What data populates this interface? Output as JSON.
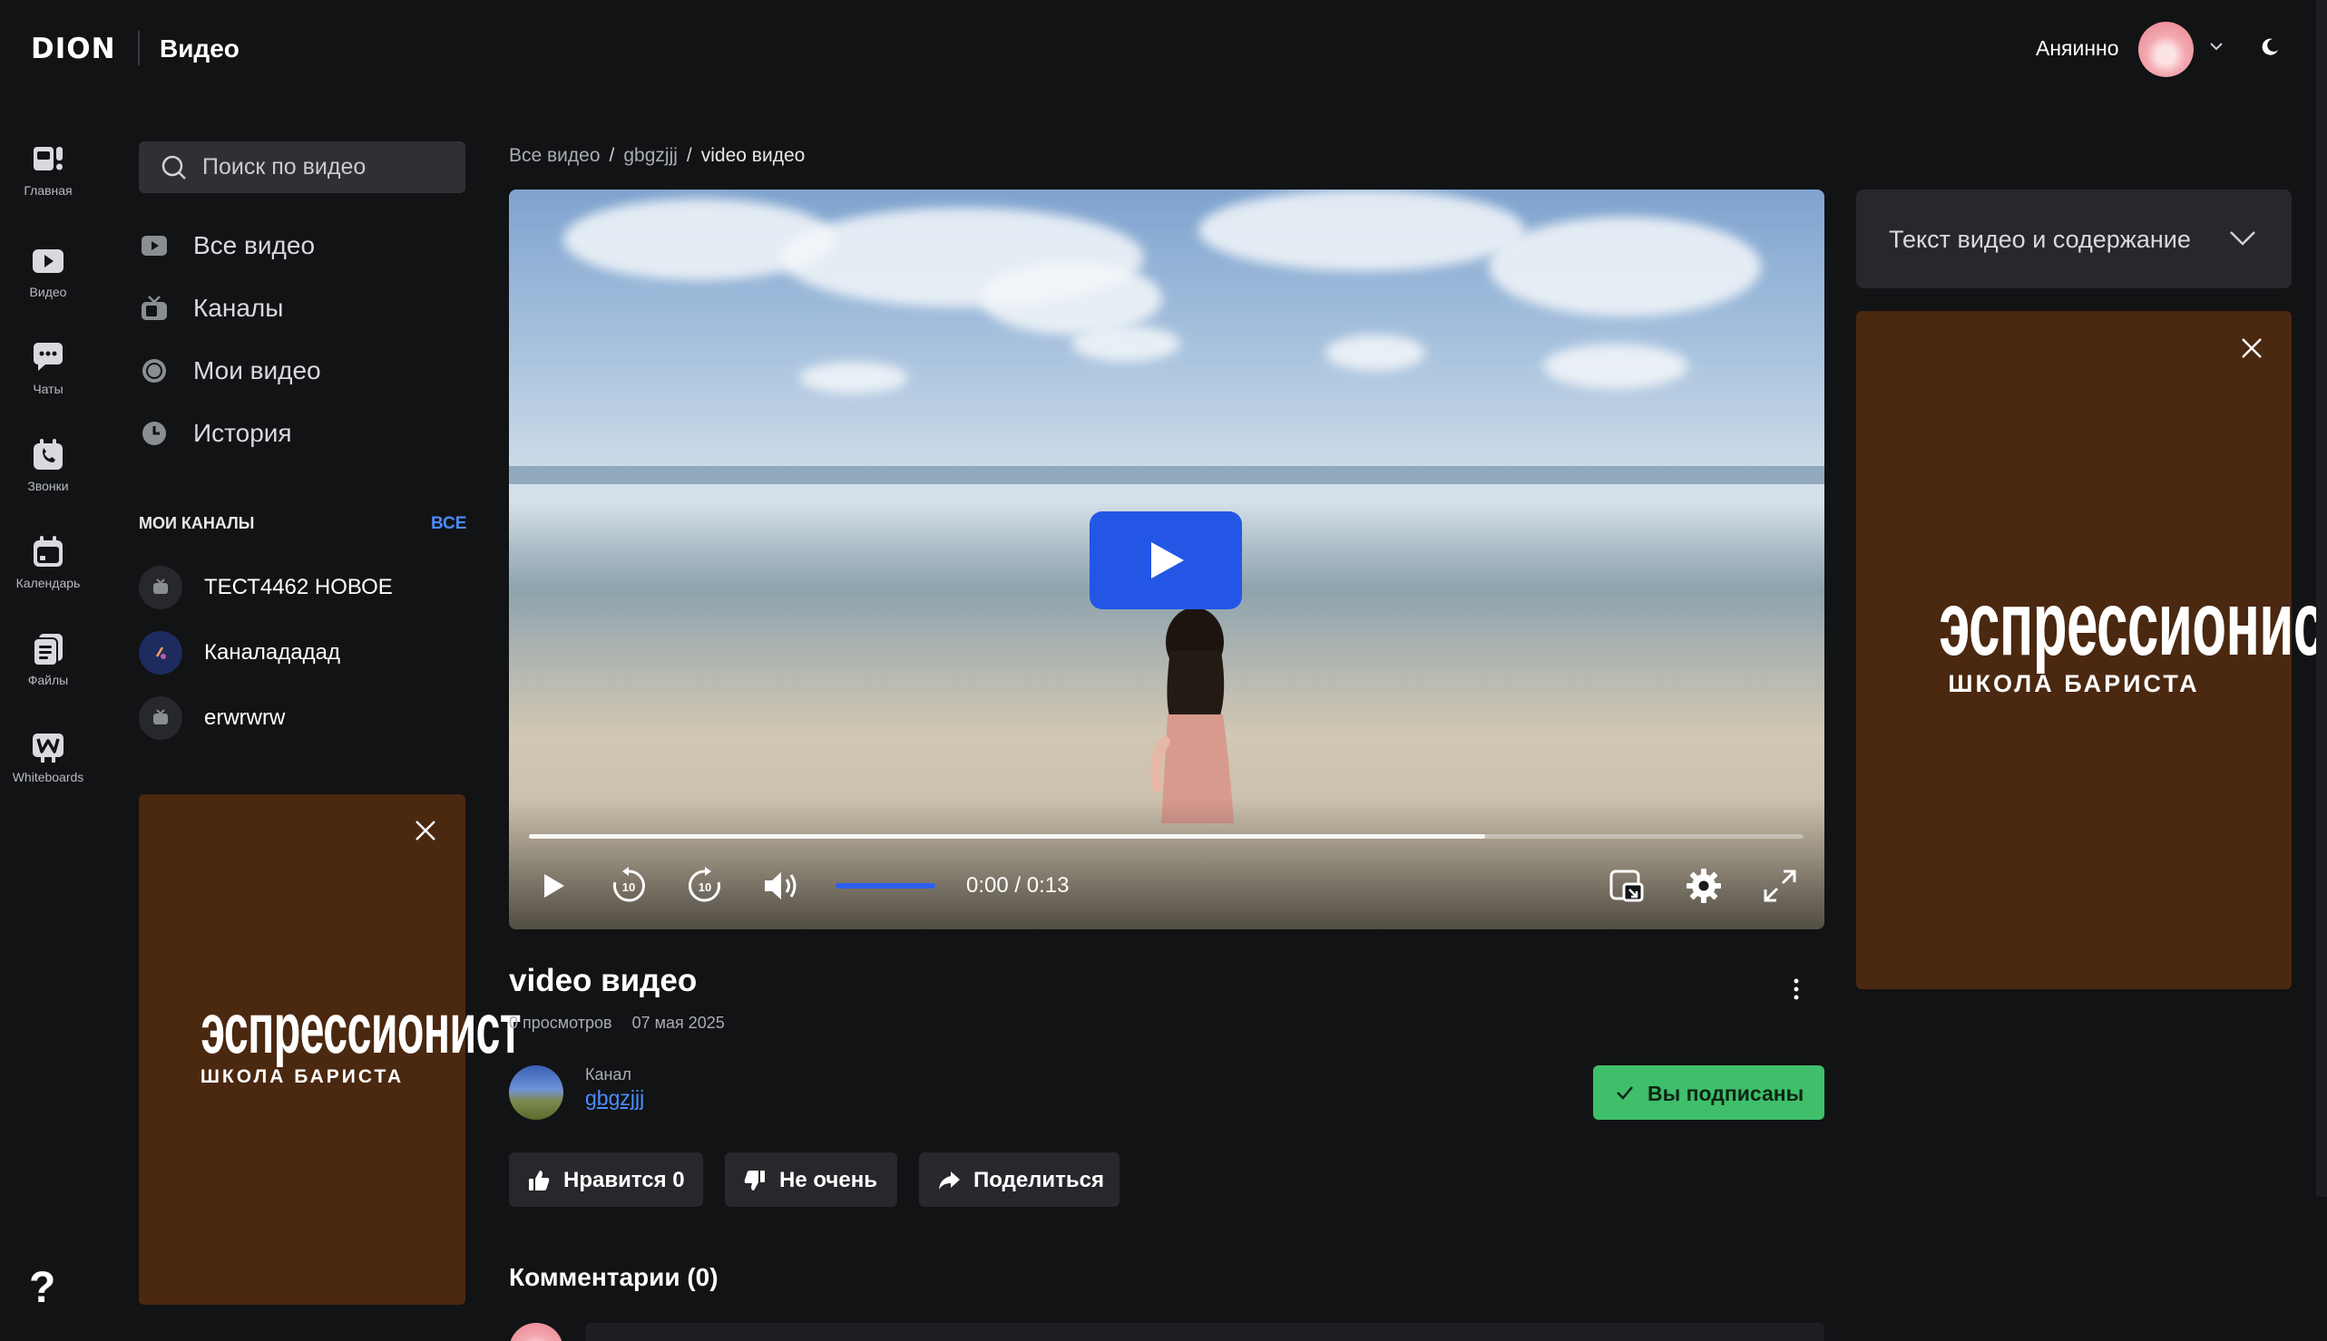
{
  "header": {
    "logo": "DION",
    "section_title": "Видео",
    "username": "Аняинно"
  },
  "rail": [
    {
      "label": "Главная",
      "icon": "home-icon"
    },
    {
      "label": "Видео",
      "icon": "video-icon"
    },
    {
      "label": "Чаты",
      "icon": "chat-icon"
    },
    {
      "label": "Звонки",
      "icon": "calls-icon"
    },
    {
      "label": "Календарь",
      "icon": "calendar-icon"
    },
    {
      "label": "Файлы",
      "icon": "files-icon"
    },
    {
      "label": "Whiteboards",
      "icon": "whiteboard-icon"
    }
  ],
  "help": "?",
  "sidebar": {
    "search_placeholder": "Поиск по видео",
    "nav": [
      {
        "label": "Все видео",
        "icon": "play-square-icon"
      },
      {
        "label": "Каналы",
        "icon": "tv-icon"
      },
      {
        "label": "Мои видео",
        "icon": "record-icon"
      },
      {
        "label": "История",
        "icon": "clock-icon"
      }
    ],
    "channels_heading": "МОИ КАНАЛЫ",
    "channels_all": "ВСЕ",
    "channels": [
      {
        "name": "ТЕСТ4462 НОВОЕ"
      },
      {
        "name": "Каналададад"
      },
      {
        "name": "erwrwrw"
      }
    ]
  },
  "ads": {
    "title": "эспрессионист",
    "subtitle": "ШКОЛА БАРИСТА"
  },
  "breadcrumb": [
    "Все видео",
    "gbgzjjj",
    "video видео"
  ],
  "player": {
    "current_time": "0:00",
    "duration": "0:13",
    "time_display": "0:00 / 0:13",
    "progress": 0.0,
    "buffered": 0.75,
    "volume": 1.0
  },
  "transcript_label": "Текст видео и содержание",
  "video": {
    "title": "video видео",
    "views": "0 просмотров",
    "date": "07 мая 2025",
    "channel_label": "Канал",
    "channel_name": "gbgzjjj",
    "subscribed_label": "Вы подписаны",
    "like_label": "Нравится 0",
    "dislike_label": "Не очень",
    "share_label": "Поделиться",
    "comments_heading": "Комментарии (0)"
  },
  "colors": {
    "accent": "#2456e6",
    "link": "#4a8dff",
    "subscribed": "#3fbf6a",
    "ad_background": "#4b2810"
  }
}
